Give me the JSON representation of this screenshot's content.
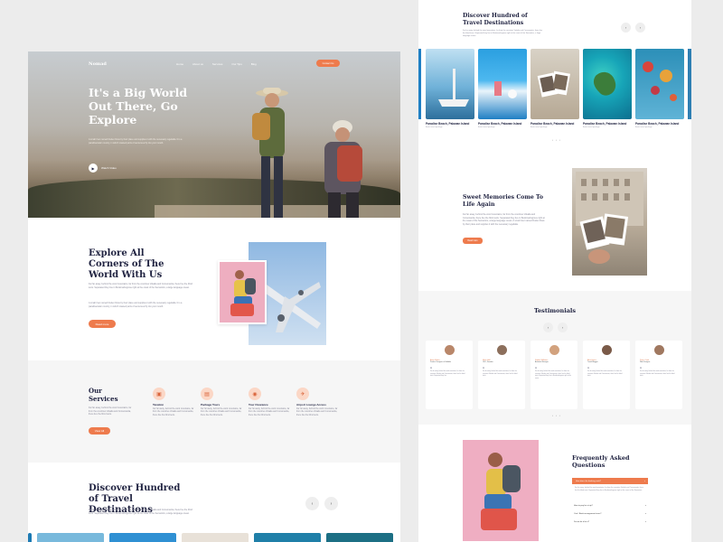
{
  "hero": {
    "logo": "Nomad",
    "nav": [
      "Home",
      "About us",
      "Services",
      "Our Tips",
      "Blog"
    ],
    "cta": "Contact Us",
    "title": "It's a Big World Out There, Go Explore",
    "text": "A small river named Duden flows by their place and supplies it with the necessary regelialia. It is a paradisematic country, in which roasted parts of sentences fly into your mouth.",
    "play_label": "Watch Video"
  },
  "explore": {
    "title": "Explore All Corners of The World With Us",
    "p1": "Far far away, behind the word mountains, far from the countries Vokalia and Consonantia, there live the blind texts. Separated they live in Bookmarksgrove right at the coast of the Semantics, a large language ocean.",
    "p2": "A small river named Duden flows by their place and supplies it with the necessary regelialia. It is a paradisematic country, in which roasted parts of sentences fly into your mouth.",
    "button": "Read more"
  },
  "services": {
    "title": "Our Services",
    "text": "Far far away, behind the word mountains, far from the countries Vokalia and Consonantia, there live the blind texts.",
    "button": "View All",
    "items": [
      {
        "icon": "passport-icon",
        "title": "Taxation",
        "text": "Far far away, behind the word mountains, far from the countries Vokalia and Consonantia, there live the blind texts."
      },
      {
        "icon": "luggage-icon",
        "title": "Package Tours",
        "text": "Far far away, behind the word mountains, far from the countries Vokalia and Consonantia, there live the blind texts."
      },
      {
        "icon": "camera-icon",
        "title": "Tour Clearance",
        "text": "Far far away, behind the word mountains, far from the countries Vokalia and Consonantia, there live the blind texts."
      },
      {
        "icon": "plane-icon",
        "title": "Airport Lounge Access",
        "text": "Far far away, behind the word mountains, far from the countries Vokalia and Consonantia, there live the blind texts."
      }
    ]
  },
  "discover": {
    "title": "Discover Hundred of Travel Destinations",
    "text": "Far far away, behind the word mountains, far from the countries Vokalia and Consonantia, there live the blind texts. Separated they live in Bookmarksgrove right at the coast of the Semantics, a large language ocean."
  },
  "right": {
    "title": "Discover Hundred of Travel Destinations",
    "text": "Far far away, behind the word mountains, far from the countries Vokalia and Consonantia, there live the blind texts. Separated they live in Bookmarksgrove right at the coast of the Semantics, a large language ocean.",
    "cards": [
      {
        "caption": "Paradise Beach, Palawan Island",
        "sub": "Basic travel package"
      },
      {
        "caption": "Paradise Beach, Palawan Island",
        "sub": "Basic travel package"
      },
      {
        "caption": "Paradise Beach, Palawan Island",
        "sub": "Basic travel package"
      },
      {
        "caption": "Paradise Beach, Palawan Island",
        "sub": "Basic travel package"
      },
      {
        "caption": "Paradise Beach, Palawan Island",
        "sub": "Basic travel package"
      }
    ],
    "pager": "• • •"
  },
  "memories": {
    "title": "Sweet Memories Come To Life Again",
    "text": "Far far away, behind the word mountains, far from the countries Vokalia and Consonantia, there live the blind texts. Separated they live in Bookmarksgrove right at the coast of the Semantics, a large language ocean. A small river named Duden flows by their place and supplies it with the necessary regelialia.",
    "button": "Read more"
  },
  "testimonials": {
    "title": "Testimonials",
    "items": [
      {
        "name": "Anna Marks",
        "role": "Product Designer at Dribbble",
        "text": "Far far away, behind the word mountains, far from the countries Vokalia and Consonantia, there live the blind texts. Separated they live."
      },
      {
        "name": "Mark Hall",
        "role": "CEO, Founder",
        "text": "Far far away, behind the word mountains, far from the countries Vokalia and Consonantia, there live the blind texts."
      },
      {
        "name": "Sophia Williams",
        "role": "Assistant Manager",
        "text": "Far far away, behind the word mountains, far from the countries Vokalia and Consonantia, there live the blind texts. Separated they live in Bookmarksgrove right at the coast."
      },
      {
        "name": "Alex Harris",
        "role": "Travel Blogger",
        "text": "Far far away, behind the word mountains, far from the countries Vokalia and Consonantia, there live the blind texts."
      },
      {
        "name": "Peter Cook",
        "role": "Web Designer",
        "text": "Far far away, behind the word mountains, far from the countries Vokalia and Consonantia, there live the blind texts."
      }
    ],
    "pager": "• • •"
  },
  "faq": {
    "title": "Frequently Asked Questions",
    "open_question": "How does the booking work?",
    "answer": "Far far away, behind the word mountains, far from the countries Vokalia and Consonantia, there live the blind texts. Separated they live in Bookmarksgrove right at the coast of the Semantics.",
    "questions": [
      "How to pay for a trip?",
      "Can I Book arrangement tours?",
      "Do we do it for it?"
    ]
  },
  "colors": {
    "accent": "#ee7b4d",
    "navy": "#1f2240"
  }
}
